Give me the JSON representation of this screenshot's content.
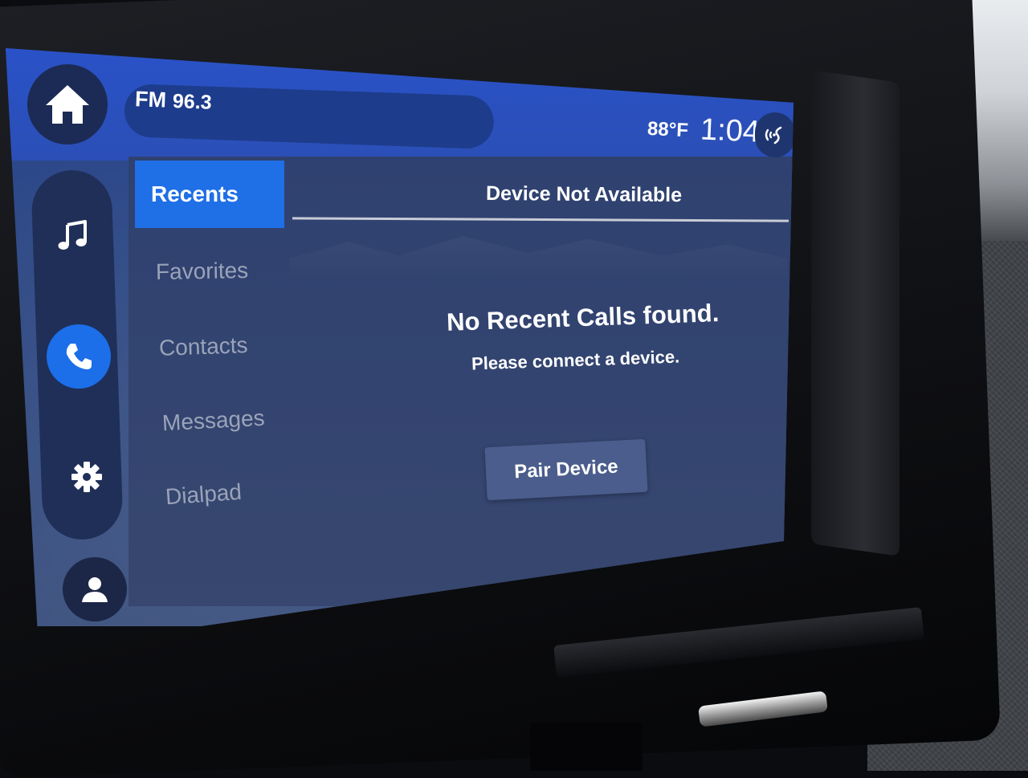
{
  "status_bar": {
    "radio_band": "FM",
    "radio_frequency": "96.3",
    "temperature": "88°F",
    "time": "1:04"
  },
  "rail": {
    "icons": [
      "home-icon",
      "music-icon",
      "phone-icon",
      "settings-icon",
      "profile-icon"
    ],
    "active": "phone-icon",
    "active_color": "#1c6ee9"
  },
  "phone": {
    "tabs": [
      {
        "label": "Recents",
        "active": true
      },
      {
        "label": "Favorites",
        "active": false
      },
      {
        "label": "Contacts",
        "active": false
      },
      {
        "label": "Messages",
        "active": false
      },
      {
        "label": "Dialpad",
        "active": false
      }
    ],
    "device_status": "Device Not Available",
    "empty_title": "No Recent Calls found.",
    "empty_subtitle": "Please connect a device.",
    "pair_button_label": "Pair Device"
  },
  "colors": {
    "accent": "#1f6fe6",
    "panel": "#2f4170",
    "top_bar": "#2a52c8"
  }
}
